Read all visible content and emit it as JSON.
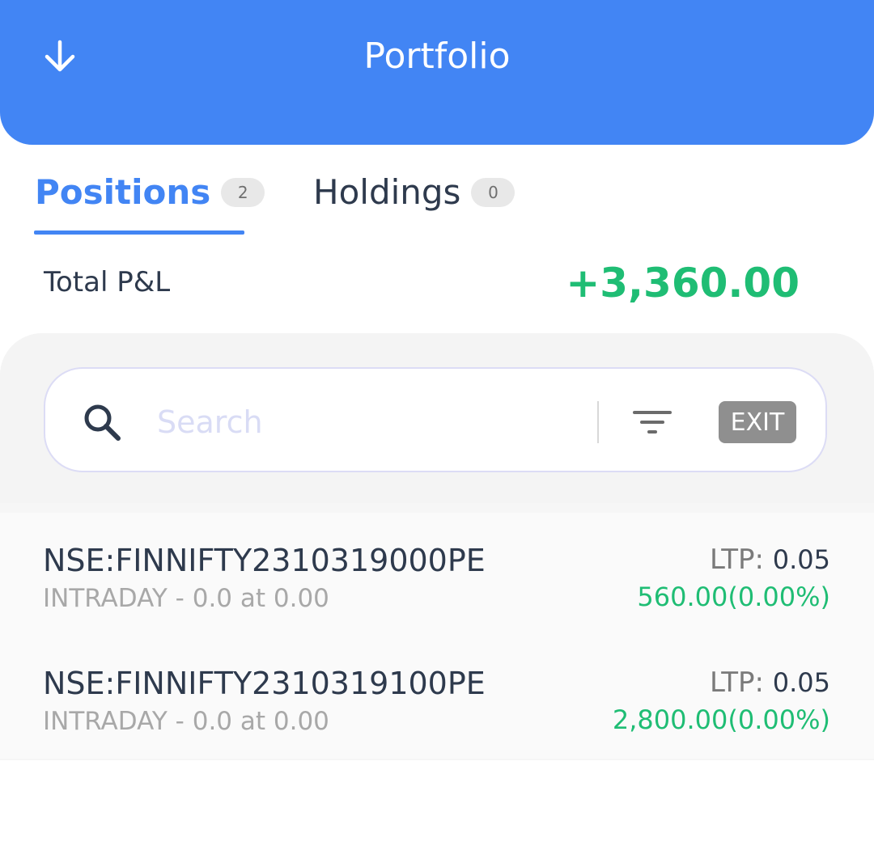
{
  "header": {
    "title": "Portfolio",
    "back_icon": "arrow-down-icon"
  },
  "tabs": [
    {
      "label": "Positions",
      "count": "2",
      "active": true
    },
    {
      "label": "Holdings",
      "count": "0",
      "active": false
    }
  ],
  "summary": {
    "label": "Total P&L",
    "value": "+3,360.00"
  },
  "search": {
    "placeholder": "Search",
    "value": "",
    "exit_label": "EXIT",
    "icons": [
      "search-icon",
      "filter-icon"
    ]
  },
  "positions": [
    {
      "symbol": "NSE:FINNIFTY2310319000PE",
      "product": "INTRADAY - ",
      "qty_price": " 0.0 at 0.00",
      "ltp_label": "LTP: ",
      "ltp_value": "0.05",
      "pnl": "560.00(0.00%)"
    },
    {
      "symbol": "NSE:FINNIFTY2310319100PE",
      "product": "INTRADAY - ",
      "qty_price": " 0.0 at 0.00",
      "ltp_label": "LTP: ",
      "ltp_value": "0.05",
      "pnl": "2,800.00(0.00%)"
    }
  ],
  "colors": {
    "primary": "#4285f4",
    "profit": "#1fbd74",
    "text": "#2e3a4d",
    "muted": "#a8a8a8"
  }
}
